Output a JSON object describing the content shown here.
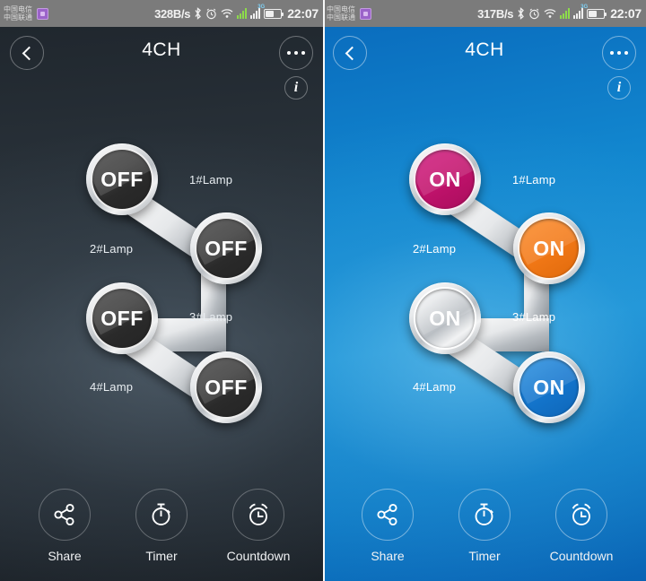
{
  "app": {
    "title": "4CH",
    "back_icon": "chevron-left-icon",
    "more_icon": "more-options-icon",
    "info_icon": "info-icon"
  },
  "panels": [
    {
      "id": "off-state",
      "theme": "dark",
      "status_bar": {
        "carrier_line1": "中国电信",
        "carrier_line2": "中国联通",
        "net_speed": "328B/s",
        "bluetooth_icon": "bluetooth-icon",
        "alarm_icon": "alarm-icon",
        "wifi_icon": "wifi-icon",
        "signal_icon_1": "signal-bars-icon",
        "signal_icon_2": "signal-bars-icon",
        "signal_tag": "3G",
        "battery_icon": "battery-icon",
        "clock": "22:07"
      },
      "switches": [
        {
          "label": "1#Lamp",
          "state": "OFF",
          "color": "#2a2a2a"
        },
        {
          "label": "2#Lamp",
          "state": "OFF",
          "color": "#2a2a2a"
        },
        {
          "label": "3#Lamp",
          "state": "OFF",
          "color": "#2a2a2a"
        },
        {
          "label": "4#Lamp",
          "state": "OFF",
          "color": "#2a2a2a"
        }
      ],
      "toolbar": [
        {
          "label": "Share",
          "icon": "share-nodes-icon"
        },
        {
          "label": "Timer",
          "icon": "stopwatch-icon"
        },
        {
          "label": "Countdown",
          "icon": "alarm-clock-icon"
        }
      ]
    },
    {
      "id": "on-state",
      "theme": "blue",
      "status_bar": {
        "carrier_line1": "中国电信",
        "carrier_line2": "中国联通",
        "net_speed": "317B/s",
        "bluetooth_icon": "bluetooth-icon",
        "alarm_icon": "alarm-icon",
        "wifi_icon": "wifi-icon",
        "signal_icon_1": "signal-bars-icon",
        "signal_icon_2": "signal-bars-icon",
        "signal_tag": "3G",
        "battery_icon": "battery-icon",
        "clock": "22:07"
      },
      "switches": [
        {
          "label": "1#Lamp",
          "state": "ON",
          "color": "#c4136e"
        },
        {
          "label": "2#Lamp",
          "state": "ON",
          "color": "#f47a18"
        },
        {
          "label": "3#Lamp",
          "state": "ON",
          "color": "#00c234"
        },
        {
          "label": "4#Lamp",
          "state": "ON",
          "color": "#1578d0"
        }
      ],
      "toolbar": [
        {
          "label": "Share",
          "icon": "share-nodes-icon"
        },
        {
          "label": "Timer",
          "icon": "stopwatch-icon"
        },
        {
          "label": "Countdown",
          "icon": "alarm-clock-icon"
        }
      ]
    }
  ]
}
